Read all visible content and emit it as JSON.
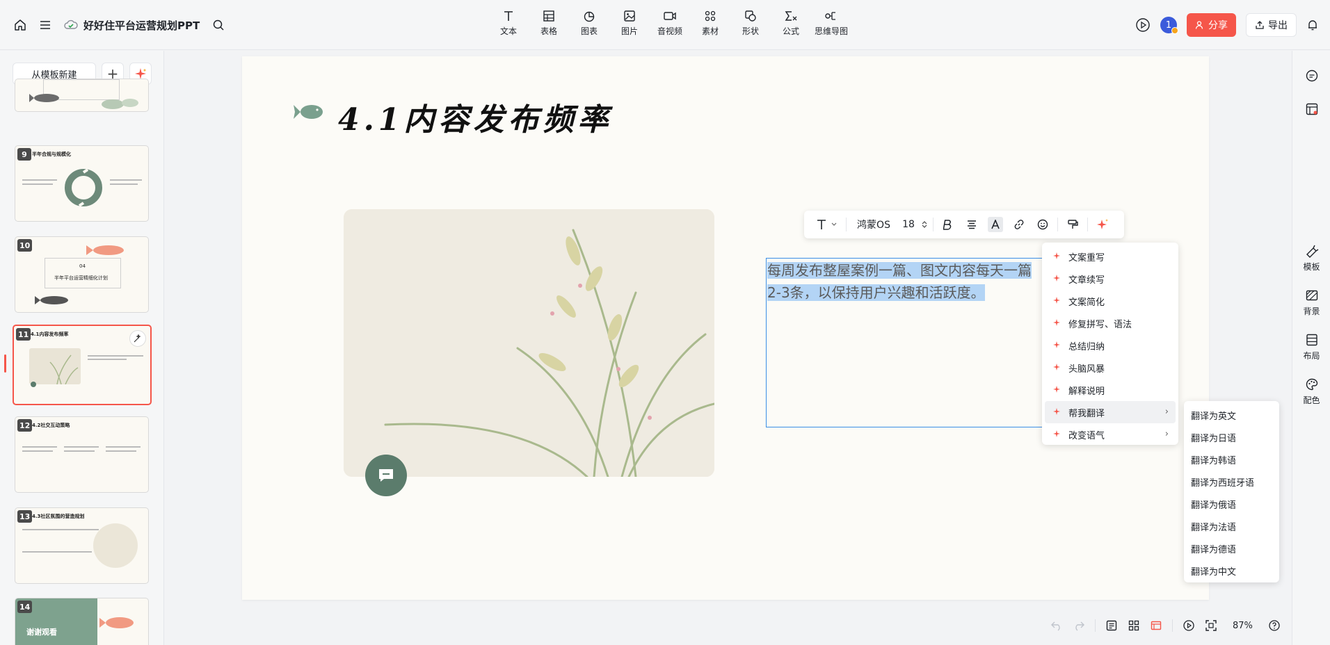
{
  "header": {
    "doc_title": "好好住平台运营规划PPT",
    "tools": [
      {
        "label": "文本",
        "icon": "text-icon"
      },
      {
        "label": "表格",
        "icon": "table-icon"
      },
      {
        "label": "图表",
        "icon": "chart-icon"
      },
      {
        "label": "图片",
        "icon": "image-icon"
      },
      {
        "label": "音视频",
        "icon": "video-icon"
      },
      {
        "label": "素材",
        "icon": "assets-icon"
      },
      {
        "label": "形状",
        "icon": "shape-icon"
      },
      {
        "label": "公式",
        "icon": "formula-icon"
      },
      {
        "label": "思维导图",
        "icon": "mindmap-icon"
      }
    ],
    "avatar_count": "1",
    "share_label": "分享",
    "export_label": "导出"
  },
  "left_panel": {
    "new_from_template": "从模板新建",
    "add_label": "+",
    "thumbnails": [
      {
        "num": "9",
        "title": "半年合规与规模化"
      },
      {
        "num": "10",
        "title": "半年平台运营精细化计划",
        "sub": "04"
      },
      {
        "num": "11",
        "title": "4.1内容发布频率"
      },
      {
        "num": "12",
        "title": "4.2社交互动策略"
      },
      {
        "num": "13",
        "title": "4.3社区氛围的营造规划"
      },
      {
        "num": "14",
        "title": "谢谢观看"
      }
    ]
  },
  "slide": {
    "title": "4.1内容发布频率",
    "body_text": "每周发布整屋案例一篇、图文内容每天一篇，2-3条，以保持用户兴趣和活跃度。",
    "body_line1": "每周发布整屋案例一篇、图文内容每天一篇",
    "body_line2": "2-3条，以保持用户兴趣和活跃度。"
  },
  "format_toolbar": {
    "font_name": "鸿蒙OS",
    "font_size": "18"
  },
  "ai_menu": {
    "items": [
      {
        "label": "文案重写"
      },
      {
        "label": "文章续写"
      },
      {
        "label": "文案简化"
      },
      {
        "label": "修复拼写、语法"
      },
      {
        "label": "总结归纳"
      },
      {
        "label": "头脑风暴"
      },
      {
        "label": "解释说明"
      },
      {
        "label": "帮我翻译"
      },
      {
        "label": "改变语气"
      }
    ],
    "submenu": [
      "翻译为英文",
      "翻译为日语",
      "翻译为韩语",
      "翻译为西班牙语",
      "翻译为俄语",
      "翻译为法语",
      "翻译为德语",
      "翻译为中文"
    ]
  },
  "right_rail": {
    "items": [
      {
        "label": "模板"
      },
      {
        "label": "背景"
      },
      {
        "label": "布局"
      },
      {
        "label": "配色"
      }
    ]
  },
  "bottom_bar": {
    "zoom": "87%"
  },
  "colors": {
    "accent_red": "#f5564a",
    "selection_blue": "#3a8ee6",
    "sage_green": "#5b7c6c"
  }
}
